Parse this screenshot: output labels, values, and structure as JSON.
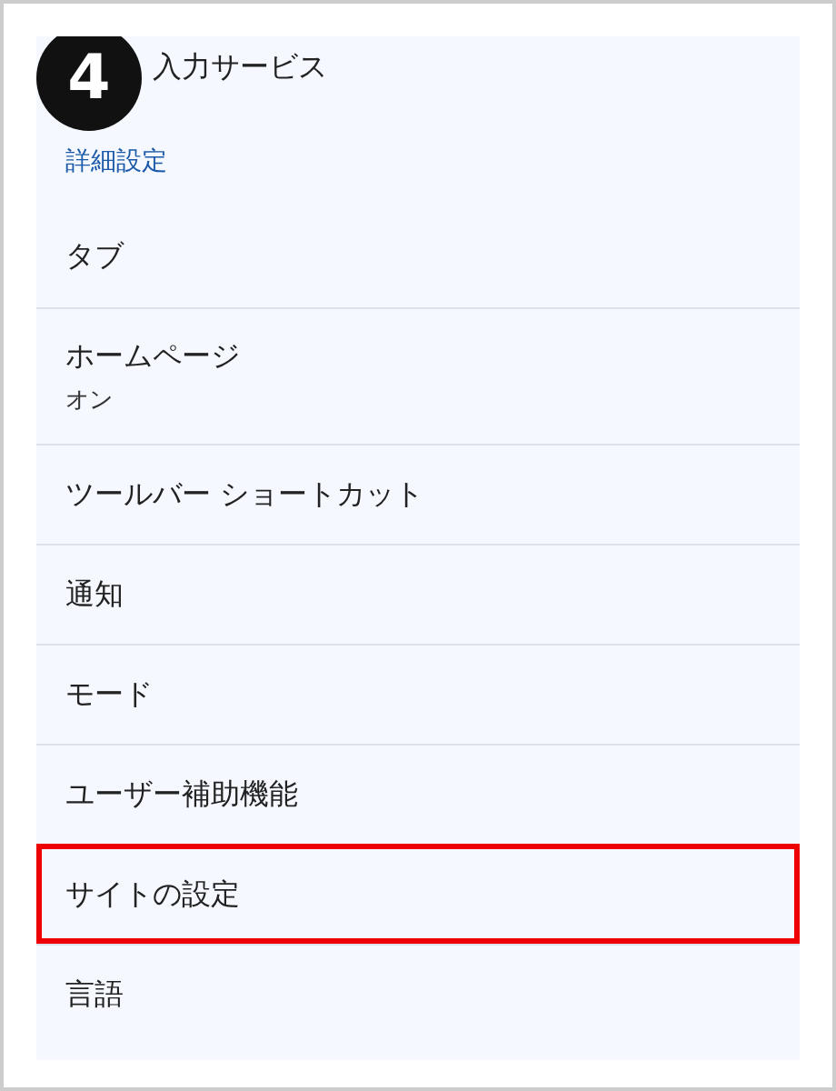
{
  "step_badge": "4",
  "items": [
    {
      "kind": "cut_item",
      "label": "入力サービス"
    },
    {
      "kind": "header",
      "label": "詳細設定"
    },
    {
      "kind": "item",
      "label": "タブ",
      "highlighted": false
    },
    {
      "kind": "item",
      "label": "ホームページ",
      "sublabel": "オン",
      "highlighted": false
    },
    {
      "kind": "item",
      "label": "ツールバー ショートカット",
      "highlighted": false
    },
    {
      "kind": "item",
      "label": "通知",
      "highlighted": false
    },
    {
      "kind": "item",
      "label": "モード",
      "highlighted": false
    },
    {
      "kind": "item",
      "label": "ユーザー補助機能",
      "highlighted": false
    },
    {
      "kind": "item",
      "label": "サイトの設定",
      "highlighted": true
    },
    {
      "kind": "item",
      "label": "言語",
      "highlighted": false
    }
  ]
}
